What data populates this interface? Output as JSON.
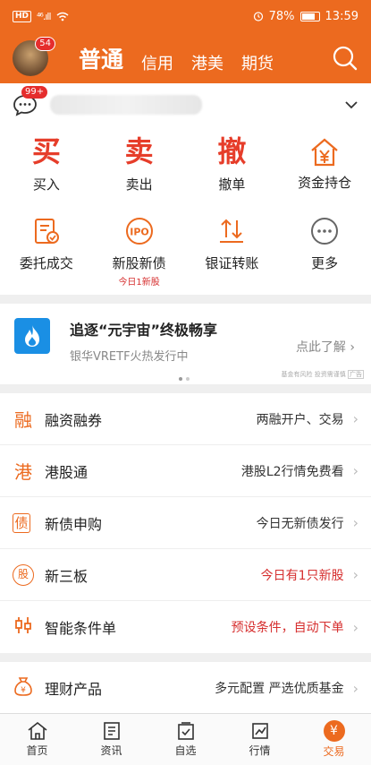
{
  "status": {
    "hd": "HD",
    "signal": "⁴⁶.ıll",
    "battery": "78%",
    "time": "13:59"
  },
  "header": {
    "badge": "54",
    "tabs": [
      "普通",
      "信用",
      "港美",
      "期货"
    ]
  },
  "account": {
    "msg_badge": "99+"
  },
  "quick_actions": [
    {
      "glyph": "买",
      "label": "买入"
    },
    {
      "glyph": "卖",
      "label": "卖出"
    },
    {
      "glyph": "撤",
      "label": "撤单"
    },
    {
      "glyph": "资金持仓",
      "label": "资金持仓"
    }
  ],
  "functions": [
    {
      "label": "委托成交",
      "icon": "order-icon"
    },
    {
      "label": "新股新债",
      "icon": "ipo-icon",
      "ipo": "IPO",
      "sub": "今日1新股"
    },
    {
      "label": "银证转账",
      "icon": "transfer-icon"
    },
    {
      "label": "更多",
      "icon": "more-icon"
    }
  ],
  "banner": {
    "title": "追逐“元宇宙”终极畅享",
    "subtitle": "银华VRETF火热发行中",
    "link": "点此了解",
    "risk": "基金有风险 投资需谨慎",
    "ad": "广告"
  },
  "services": [
    {
      "icon": "融",
      "name": "融资融券",
      "desc": "两融开户、交易",
      "red": false
    },
    {
      "icon": "港",
      "name": "港股通",
      "desc": "港股L2行情免费看",
      "red": false
    },
    {
      "icon": "债",
      "name": "新债申购",
      "desc": "今日无新债发行",
      "red": false
    },
    {
      "icon": "股",
      "name": "新三板",
      "desc": "今日有1只新股",
      "red": true
    },
    {
      "icon": "单",
      "name": "智能条件单",
      "desc": "预设条件，自动下单",
      "red": true
    }
  ],
  "finance": {
    "icon": "¥",
    "name": "理财产品",
    "desc": "多元配置 严选优质基金"
  },
  "bottom_nav": [
    "首页",
    "资讯",
    "自选",
    "行情",
    "交易"
  ],
  "colors": {
    "brand": "#ec6a1f",
    "red": "#e63d2a"
  }
}
